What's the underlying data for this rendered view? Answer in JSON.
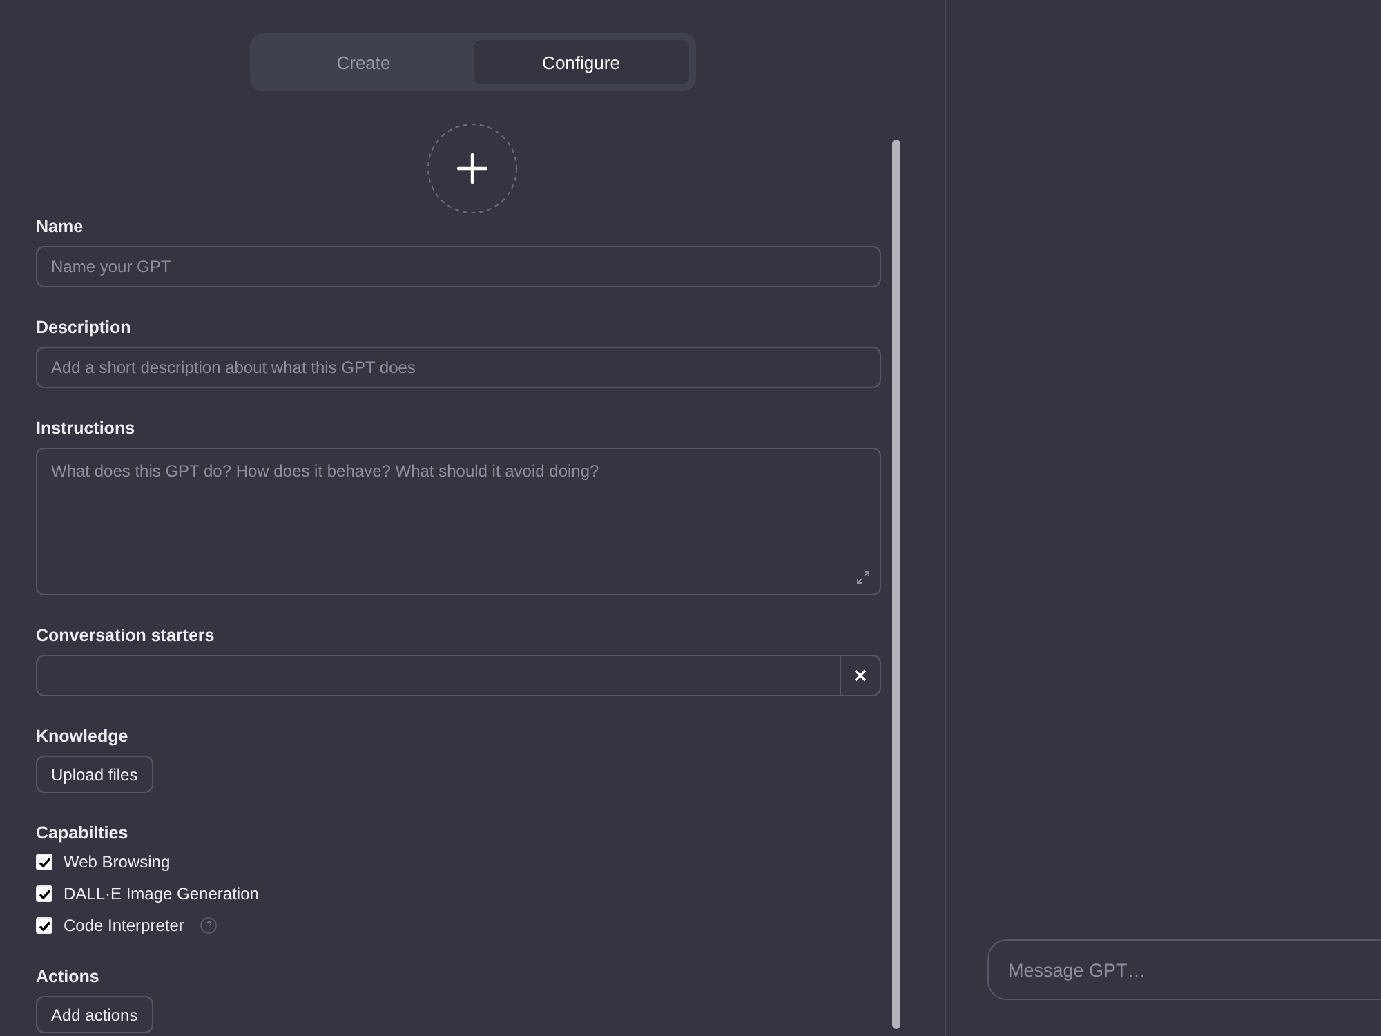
{
  "tabs": [
    {
      "label": "Create",
      "selected": false
    },
    {
      "label": "Configure",
      "selected": true
    }
  ],
  "form": [
    {
      "kind": "input",
      "label": "Name",
      "placeholder": "Name your GPT"
    },
    {
      "kind": "input",
      "label": "Description",
      "placeholder": "Add a short description about what this GPT does"
    },
    {
      "kind": "textarea",
      "label": "Instructions",
      "placeholder": "What does this GPT do? How does it behave? What should it avoid doing?"
    },
    {
      "kind": "starter",
      "label": "Conversation starters"
    },
    {
      "kind": "button",
      "label": "Knowledge",
      "button": "Upload files"
    },
    {
      "kind": "checks",
      "label": "Capabilties",
      "items": [
        {
          "label": "Web Browsing",
          "checked": true
        },
        {
          "label": "DALL·E Image Generation",
          "checked": true
        },
        {
          "label": "Code Interpreter",
          "checked": true,
          "help": "?"
        }
      ]
    },
    {
      "kind": "button",
      "label": "Actions",
      "button": "Add actions"
    }
  ],
  "preview": {
    "placeholder": "Message GPT…"
  }
}
